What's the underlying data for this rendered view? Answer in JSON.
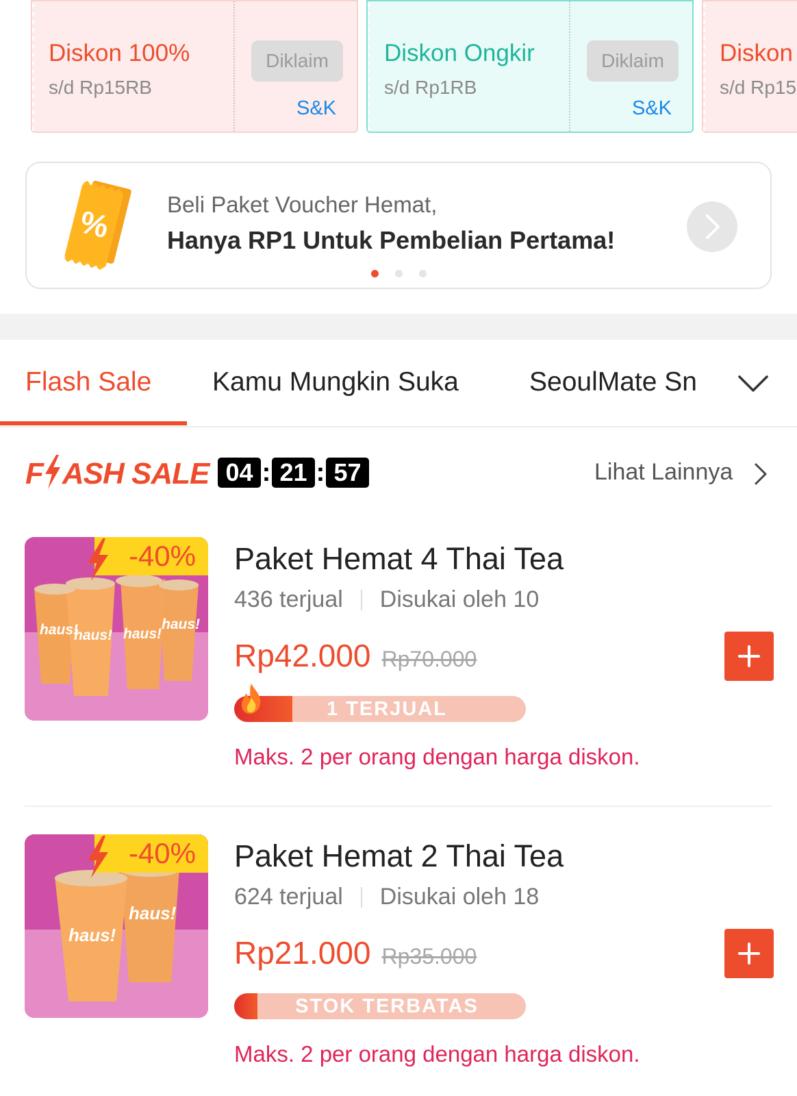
{
  "vouchers": [
    {
      "title": "Diskon 100%",
      "subtitle": "s/d Rp15RB",
      "claim_label": "Diklaim",
      "terms_label": "S&K",
      "color": "#ee4d2d"
    },
    {
      "title": "Diskon Ongkir",
      "subtitle": "s/d Rp1RB",
      "claim_label": "Diklaim",
      "terms_label": "S&K",
      "color": "#20b59a"
    },
    {
      "title": "Diskon",
      "subtitle": "s/d Rp15",
      "color": "#ee4d2d"
    }
  ],
  "promo": {
    "line1": "Beli Paket Voucher Hemat,",
    "line2": "Hanya RP1 Untuk Pembelian Pertama!",
    "icon": "voucher-ticket-icon",
    "carousel_total": 3,
    "carousel_active": 1
  },
  "tabs": [
    {
      "label": "Flash Sale",
      "active": true
    },
    {
      "label": "Kamu Mungkin Suka",
      "active": false
    },
    {
      "label": "SeoulMate Sn",
      "active": false
    }
  ],
  "flash_sale": {
    "logo_left": "F",
    "logo_right": "ASH SALE",
    "timer": {
      "hours": "04",
      "minutes": "21",
      "seconds": "57",
      "separator": ":"
    },
    "see_more": "Lihat Lainnya"
  },
  "products": [
    {
      "name": "Paket Hemat 4 Thai Tea",
      "sold": "436 terjual",
      "liked": "Disukai oleh 10",
      "price": "Rp42.000",
      "original_price": "Rp70.000",
      "discount": "-40%",
      "progress_label": "1 TERJUAL",
      "progress_fraction": 0.2,
      "limit_note": "Maks. 2 per orang dengan harga diskon.",
      "cup_label": "haus!",
      "cup_count": 4
    },
    {
      "name": "Paket Hemat 2 Thai Tea",
      "sold": "624 terjual",
      "liked": "Disukai oleh 18",
      "price": "Rp21.000",
      "original_price": "Rp35.000",
      "discount": "-40%",
      "progress_label": "STOK TERBATAS",
      "progress_fraction": 0.08,
      "limit_note": "Maks. 2 per orang dengan harga diskon.",
      "cup_label": "haus!",
      "cup_count": 2
    }
  ],
  "colors": {
    "accent": "#ee4d2d",
    "teal": "#20b59a",
    "link": "#1e88e5",
    "limit_text": "#e0255a"
  }
}
